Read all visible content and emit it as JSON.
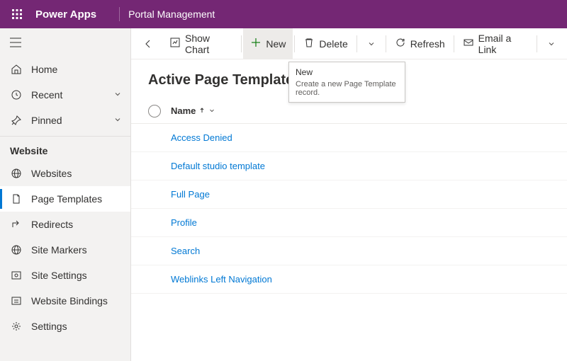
{
  "header": {
    "brand": "Power Apps",
    "app": "Portal Management"
  },
  "sidebar": {
    "top": [
      {
        "label": "Home",
        "chevron": false
      },
      {
        "label": "Recent",
        "chevron": true
      },
      {
        "label": "Pinned",
        "chevron": true
      }
    ],
    "group_label": "Website",
    "items": [
      {
        "label": "Websites"
      },
      {
        "label": "Page Templates",
        "active": true
      },
      {
        "label": "Redirects"
      },
      {
        "label": "Site Markers"
      },
      {
        "label": "Site Settings"
      },
      {
        "label": "Website Bindings"
      },
      {
        "label": "Settings"
      }
    ]
  },
  "commands": {
    "show_chart": "Show Chart",
    "new": "New",
    "delete": "Delete",
    "refresh": "Refresh",
    "email_link": "Email a Link"
  },
  "tooltip": {
    "title": "New",
    "body": "Create a new Page Template record."
  },
  "page": {
    "title": "Active Page Templates"
  },
  "grid": {
    "col_name": "Name",
    "rows": [
      "Access Denied",
      "Default studio template",
      "Full Page",
      "Profile",
      "Search",
      "Weblinks Left Navigation"
    ]
  }
}
